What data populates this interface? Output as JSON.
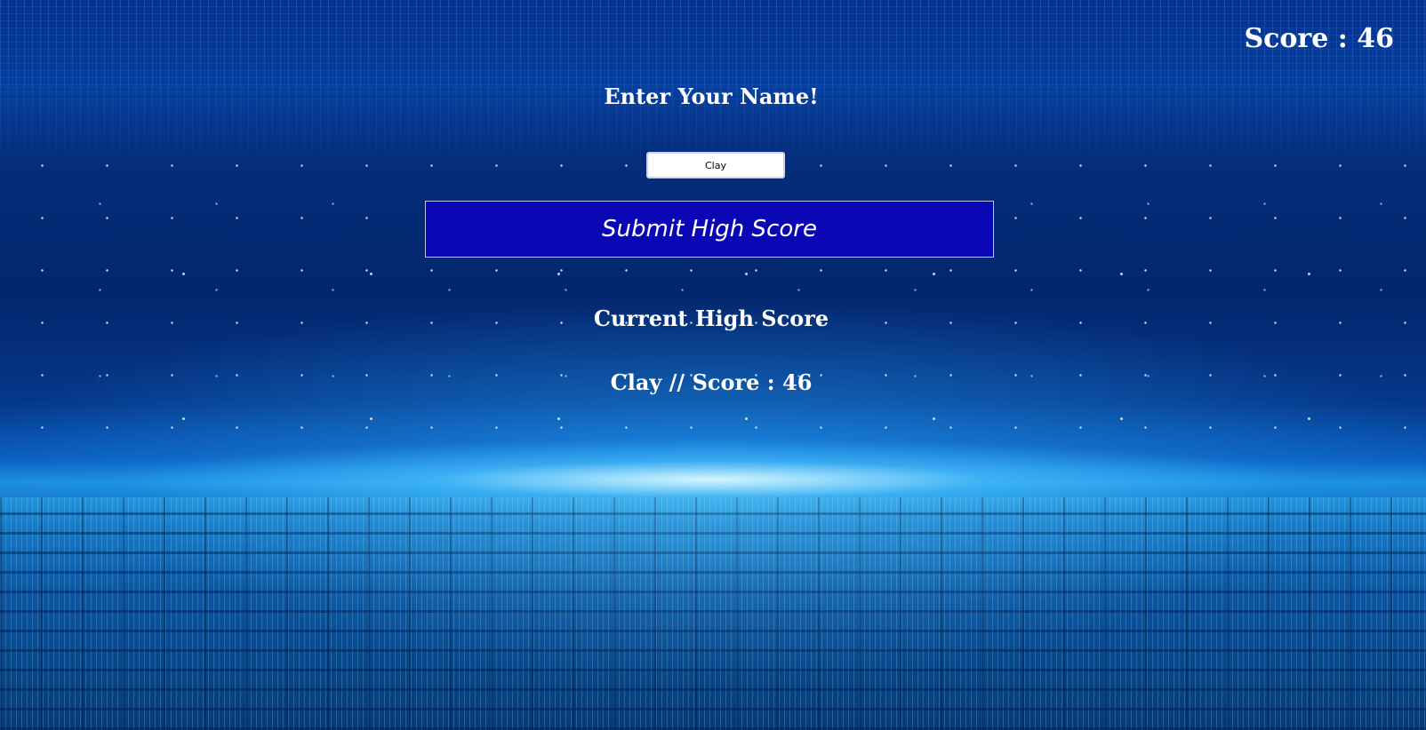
{
  "hud": {
    "score_label": "Score : 46"
  },
  "name_entry": {
    "title": "Enter Your Name!",
    "input_value": "Clay",
    "submit_label": "Submit High Score"
  },
  "high_score": {
    "title": "Current High Score",
    "player": "Clay",
    "separator": " // ",
    "score_text": "Score : 46"
  },
  "colors": {
    "button_bg": "#0a08b4",
    "text": "#ffffff"
  }
}
